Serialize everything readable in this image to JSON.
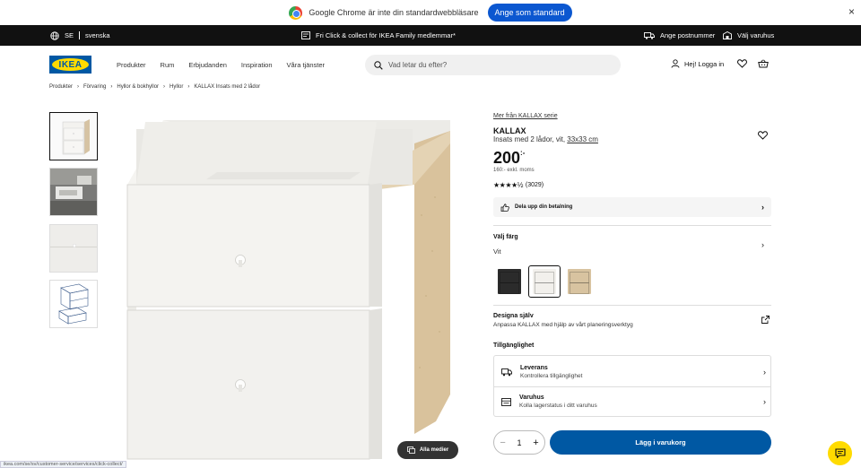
{
  "chrome_bar": {
    "message": "Google Chrome är inte din standardwebbläsare",
    "button": "Ange som standard",
    "close": "×"
  },
  "top_bar": {
    "country": "SE",
    "language": "svenska",
    "promo": "Fri Click & collect för IKEA Family medlemmar*",
    "postcode": "Ange postnummer",
    "store": "Välj varuhus"
  },
  "nav": {
    "logo": "IKEA",
    "links": [
      "Produkter",
      "Rum",
      "Erbjudanden",
      "Inspiration",
      "Våra tjänster"
    ],
    "search_placeholder": "Vad letar du efter?",
    "login": "Hej! Logga in"
  },
  "breadcrumb": [
    "Produkter",
    "Förvaring",
    "Hyllor & bokhyllor",
    "Hyllor",
    "KALLAX Insats med 2 lådor"
  ],
  "media": {
    "all_media": "Alla medier"
  },
  "product": {
    "series_link": "Mer från KALLAX serie",
    "name": "KALLAX",
    "description": "Insats med 2 lådor, vit,",
    "dimensions": "33x33 cm",
    "price": "200",
    "price_suffix": ":-",
    "price_ex_vat": "160:- exkl. moms",
    "rating_stars": "★★★★½",
    "rating_count": "(3029)",
    "split_payment": "Dela upp din betalning"
  },
  "color": {
    "title": "Välj färg",
    "selected": "Vit",
    "swatches": [
      {
        "name": "svart",
        "color": "#2b2b2b"
      },
      {
        "name": "vit",
        "color": "#f2f0ec"
      },
      {
        "name": "björk",
        "color": "#d8c3a0"
      }
    ]
  },
  "design": {
    "title": "Designa själv",
    "subtitle": "Anpassa KALLAX med hjälp av vårt planeringsverktyg"
  },
  "availability": {
    "title": "Tillgänglighet",
    "rows": [
      {
        "title": "Leverans",
        "subtitle": "Kontrollera tillgänglighet"
      },
      {
        "title": "Varuhus",
        "subtitle": "Kolla lagerstatus i ditt varuhus"
      }
    ]
  },
  "cart": {
    "quantity": "1",
    "minus": "−",
    "plus": "+",
    "add_label": "Lägg i varukorg"
  },
  "status_url": "ikea.com/se/sv/customer-service/services/click-collect/",
  "colors": {
    "ikea_blue": "#0058a3",
    "ikea_yellow": "#ffdb00",
    "chrome_blue": "#0b57d0"
  }
}
